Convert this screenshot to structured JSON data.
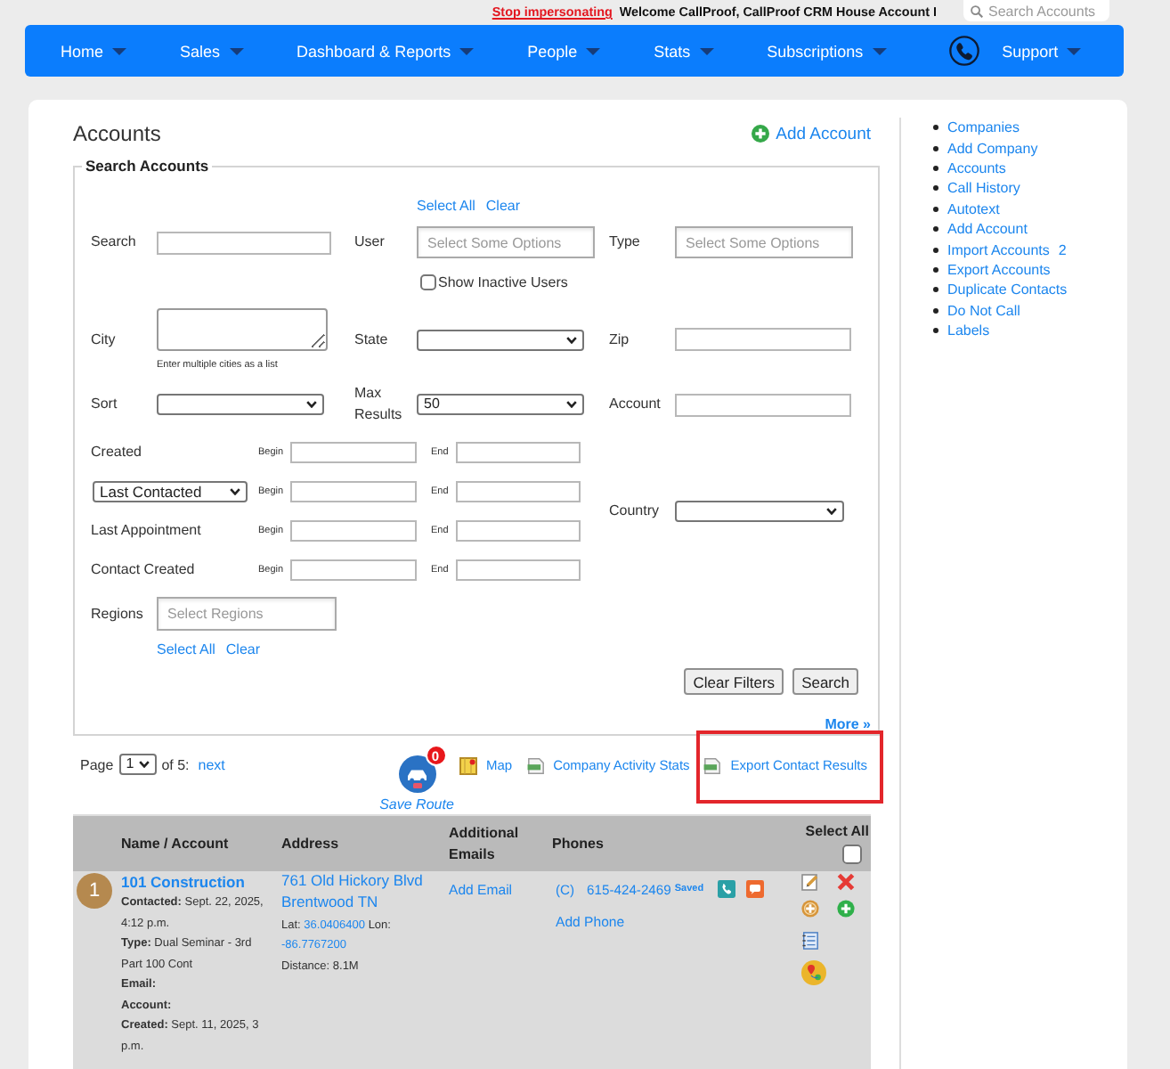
{
  "top_bar": {
    "impersonation_link": "Stop impersonating",
    "welcome": "Welcome CallProof, CallProof CRM House Account I",
    "search": {
      "placeholder": "Search Accounts"
    }
  },
  "nav": {
    "items": [
      {
        "kind": "menu",
        "label": "Home"
      },
      {
        "kind": "menu",
        "label": "Sales"
      },
      {
        "kind": "menu",
        "label": "Dashboard & Reports"
      },
      {
        "kind": "menu",
        "label": "People"
      },
      {
        "kind": "menu",
        "label": "Stats"
      },
      {
        "kind": "menu",
        "label": "Subscriptions"
      },
      {
        "kind": "phone"
      },
      {
        "kind": "menu",
        "label": "Support"
      }
    ]
  },
  "header": {
    "title": "Accounts",
    "add_link": "Add Account"
  },
  "search_form": {
    "legend": "Search Accounts",
    "search": {
      "label": "Search"
    },
    "user": {
      "label": "User",
      "placeholder": "Select Some Options",
      "links": [
        "Select All",
        "Clear"
      ],
      "show_inactive": {
        "label": "Show Inactive Users",
        "checked": false
      }
    },
    "type": {
      "label": "Type",
      "placeholder": "Select Some Options"
    },
    "city": {
      "label": "City",
      "hint": "Enter multiple cities as a list"
    },
    "state": {
      "label": "State"
    },
    "zip": {
      "label": "Zip"
    },
    "sort": {
      "label": "Sort"
    },
    "max_results": {
      "label": "Max Results",
      "value": "50"
    },
    "account": {
      "label": "Account"
    },
    "date_filters": [
      {
        "kind": "label",
        "label": "Created",
        "begin": "Begin",
        "end": "End"
      },
      {
        "kind": "select",
        "label": "Last Contacted",
        "begin": "Begin",
        "end": "End"
      },
      {
        "kind": "label",
        "label": "Last Appointment",
        "begin": "Begin",
        "end": "End"
      },
      {
        "kind": "label",
        "label": "Contact Created",
        "begin": "Begin",
        "end": "End"
      }
    ],
    "country": {
      "label": "Country"
    },
    "regions": {
      "label": "Regions",
      "placeholder": "Select Regions",
      "links": [
        "Select All",
        "Clear"
      ]
    },
    "buttons": [
      "Clear Filters",
      "Search"
    ],
    "more_link": "More »"
  },
  "results": {
    "pager": {
      "label": "Page",
      "page": "1",
      "total": "of 5:",
      "next": "next"
    },
    "save_route": {
      "label": "Save Route",
      "badge": "0"
    },
    "links": [
      {
        "kind": "map",
        "label": "Map",
        "highlighted": false
      },
      {
        "kind": "csv",
        "label": "Company Activity Stats",
        "highlighted": false
      },
      {
        "kind": "csv",
        "label": "Export Contact Results",
        "highlighted": true
      }
    ]
  },
  "table": {
    "columns": [
      "Name / Account",
      "Address",
      "Additional Emails",
      "Phones"
    ],
    "select_all": {
      "label": "Select All",
      "checked": false
    },
    "rows": [
      {
        "number": "1",
        "name": "101 Construction",
        "details": [
          {
            "label": "Contacted:",
            "value": "Sept. 22, 2025, 4:12 p.m."
          },
          {
            "label": "Type:",
            "value": "Dual Seminar - 3rd Part 100 Cont"
          },
          {
            "label": "Email:"
          },
          {
            "label": "Account:"
          },
          {
            "label": "Created:",
            "value": "Sept. 11, 2025, 3 p.m."
          }
        ],
        "address": [
          "761 Old Hickory Blvd",
          "Brentwood TN"
        ],
        "lat_label": "Lat:",
        "lat": "36.0406400",
        "lon_label": "Lon:",
        "lon": "-86.7767200",
        "distance": "Distance: 8.1M",
        "email_link": "Add Email",
        "phones": [
          {
            "type": "(C)",
            "number": "615-424-2469",
            "status": "Saved"
          }
        ],
        "add_phone": "Add Phone"
      }
    ]
  },
  "sidebar": {
    "links": [
      {
        "label": "Companies"
      },
      {
        "label": "Add Company"
      },
      {
        "label": "Accounts"
      },
      {
        "label": "Call History"
      },
      {
        "label": "Autotext"
      },
      {
        "label": "Add Account"
      },
      {
        "label": "Import Accounts",
        "count": "2"
      },
      {
        "label": "Export Accounts"
      },
      {
        "label": "Duplicate Contacts"
      },
      {
        "label": "Do Not Call"
      },
      {
        "label": "Labels"
      }
    ]
  }
}
